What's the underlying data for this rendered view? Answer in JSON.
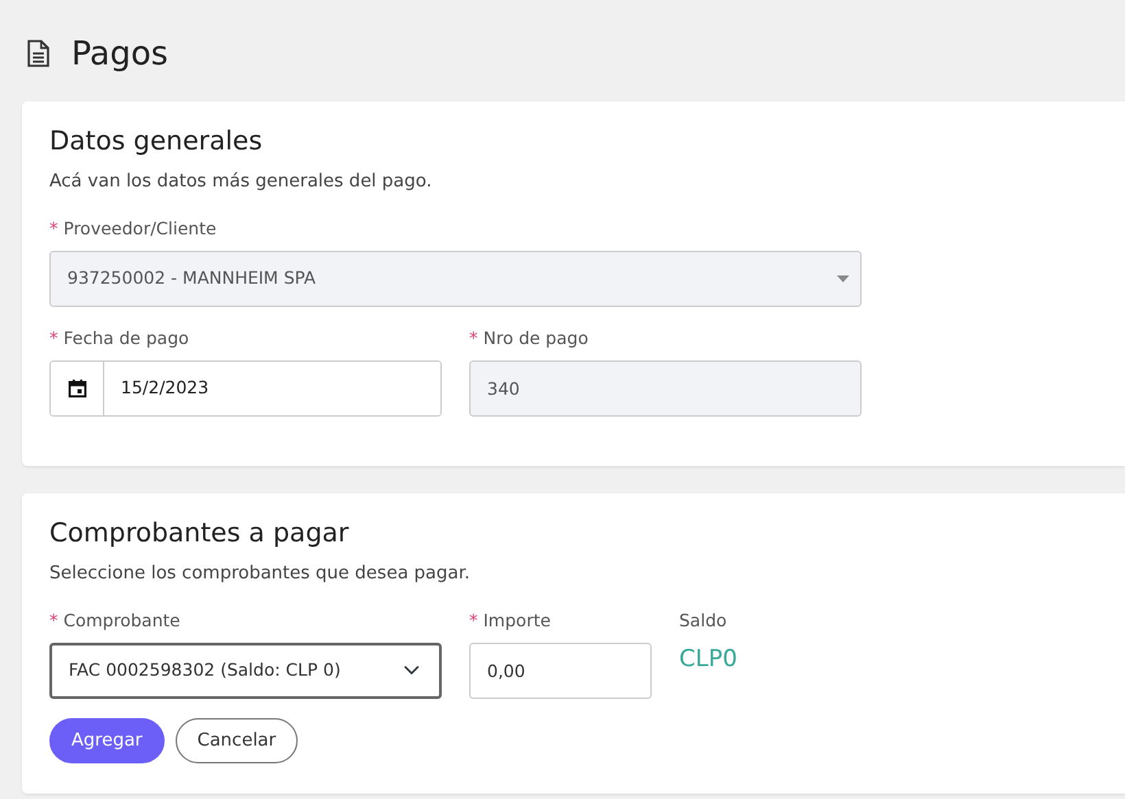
{
  "page_title": "Pagos",
  "sections": [
    {
      "title": "Datos generales",
      "description": "Acá van los datos más generales del pago.",
      "rows": [
        [
          {
            "kind": "select",
            "required_mark": "*",
            "label": "Proveedor/Cliente",
            "value": "937250002 - MANNHEIM SPA",
            "disabled": true
          }
        ],
        [
          {
            "kind": "date",
            "required_mark": "*",
            "label": "Fecha de pago",
            "value": "15/2/2023"
          },
          {
            "kind": "input",
            "required_mark": "*",
            "label": "Nro de pago",
            "value": "340",
            "disabled": true
          }
        ]
      ]
    },
    {
      "title": "Comprobantes a pagar",
      "description": "Seleccione los comprobantes que desea pagar.",
      "rows": [
        [
          {
            "kind": "native-select",
            "required_mark": "*",
            "label": "Comprobante",
            "value": "FAC 0002598302 (Saldo: CLP 0)",
            "disabled": false
          },
          {
            "kind": "input",
            "required_mark": "*",
            "label": "Importe",
            "value": "0,00",
            "disabled": false
          },
          {
            "kind": "readout",
            "label": "Saldo",
            "value": "CLP0"
          }
        ]
      ],
      "buttons": [
        {
          "label": "Agregar",
          "kind": "primary"
        },
        {
          "label": "Cancelar",
          "kind": "outline"
        }
      ]
    }
  ]
}
